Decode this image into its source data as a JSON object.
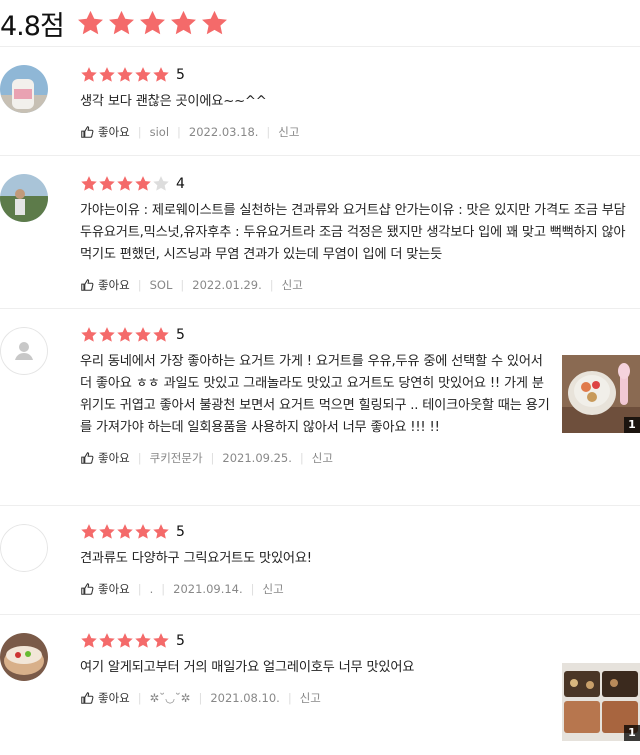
{
  "summary": {
    "average": "4.8점",
    "rating": 5
  },
  "colors": {
    "star_on": "#f46a6a",
    "star_off": "#dddddd"
  },
  "labels": {
    "like": "좋아요",
    "report": "신고"
  },
  "reviews": [
    {
      "rating": 5,
      "rating_label": "5",
      "text": "생각 보다 괜찮은 곳이에요~~^^",
      "author": "siol",
      "date": "2022.03.18.",
      "avatar": "photo",
      "photo_count": ""
    },
    {
      "rating": 4,
      "rating_label": "4",
      "text": "가야는이유 : 제로웨이스트를 실천하는 견과류와 요거트샵 안가는이유 : 맛은 있지만 가격도 조금 부담  두유요거트,믹스넛,유자후추 : 두유요거트라 조금 걱정은 됐지만 생각보다 입에 꽤 맞고 뻑뻑하지 않아 먹기도 편했던, 시즈닝과 무염 견과가 있는데 무염이 입에 더 맞는듯",
      "author": "SOL",
      "date": "2022.01.29.",
      "avatar": "photo",
      "photo_count": ""
    },
    {
      "rating": 5,
      "rating_label": "5",
      "text": "우리 동네에서 가장 좋아하는 요거트 가게 ! 요거트를 우유,두유 중에 선택할 수 있어서 더 좋아요 ㅎㅎ 과일도 맛있고 그래놀라도 맛있고 요거트도 당연히 맛있어요 !! 가게 분위기도 귀엽고 좋아서 불광천 보면서 요거트 먹으면 힐링되구 .. 테이크아웃할 때는 용기를 가져가야 하는데 일회용품을 사용하지 않아서 너무 좋아요 !!! !!",
      "author": "쿠키전문가",
      "date": "2021.09.25.",
      "avatar": "default",
      "photo_count": "1"
    },
    {
      "rating": 5,
      "rating_label": "5",
      "text": "견과류도 다양하구 그릭요거트도 맛있어요!",
      "author": ".",
      "date": "2021.09.14.",
      "avatar": "blank",
      "photo_count": ""
    },
    {
      "rating": 5,
      "rating_label": "5",
      "text": "여기 알게되고부터 거의 매일가요 얼그레이호두 너무 맛있어요",
      "author": "✲˘◡˘✲",
      "date": "2021.08.10.",
      "avatar": "photo",
      "photo_count": "1"
    }
  ]
}
